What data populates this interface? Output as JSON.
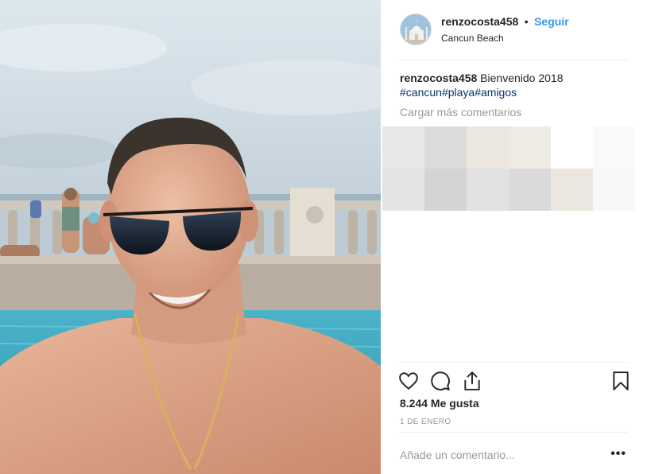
{
  "post": {
    "photo_icon": "selfie-photo",
    "header": {
      "avatar_icon": "taj-mahal-avatar-icon",
      "username": "renzocosta458",
      "separator": "•",
      "follow_label": "Seguir",
      "location": "Cancun Beach"
    },
    "caption": {
      "username": "renzocosta458",
      "text": "Bienvenido 2018",
      "hashtags": [
        "#cancun",
        "#playa",
        "#amigos"
      ]
    },
    "load_more_label": "Cargar más comentarios",
    "pixel_colors": [
      "#e8e8e8",
      "#dcdcdc",
      "#ebe7e0",
      "#eeebe2",
      "#ffffff",
      "#fafafa",
      "#e4e4e4",
      "#d4d4d4",
      "#e2e2e2",
      "#dadada",
      "#ebe6de",
      "#f7f7f7"
    ],
    "actions": {
      "like_icon": "heart-icon",
      "comment_icon": "comment-icon",
      "share_icon": "share-icon",
      "save_icon": "bookmark-icon"
    },
    "likes_text": "8.244 Me gusta",
    "date": "1 DE ENERO",
    "comment": {
      "placeholder": "Añade un comentario...",
      "more_label": "•••"
    }
  },
  "colors": {
    "follow": "#3897f0",
    "hashtag": "#003569",
    "muted": "#999999",
    "text": "#262626",
    "divider": "#efefef"
  }
}
